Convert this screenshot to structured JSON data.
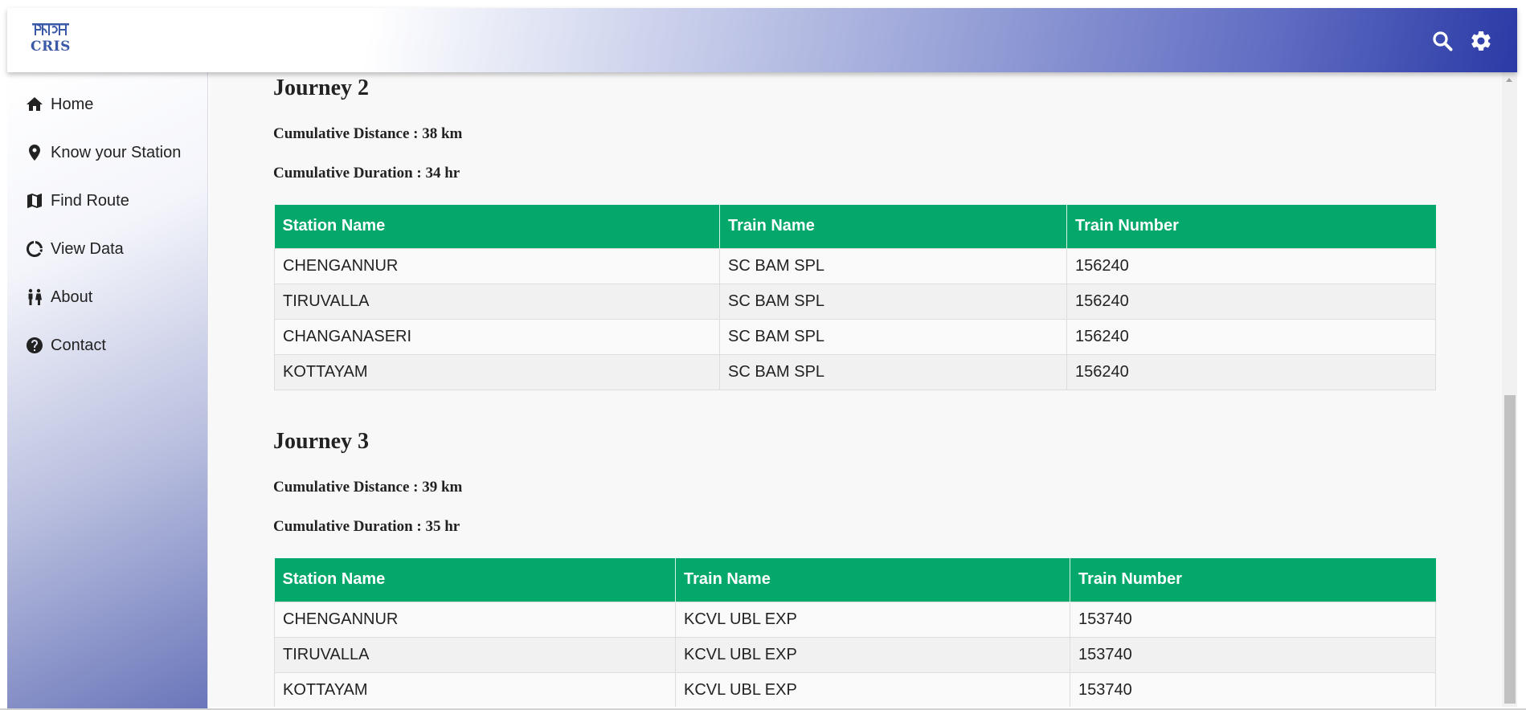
{
  "header": {
    "logo_text": "CRIS",
    "logo_hindi": "क्रिस",
    "search_icon": "search-icon",
    "settings_icon": "gear-icon",
    "accent": "#2b3aa6"
  },
  "sidebar": {
    "items": [
      {
        "label": "Home",
        "icon": "home-icon"
      },
      {
        "label": "Know your Station",
        "icon": "location-pin-icon"
      },
      {
        "label": "Find Route",
        "icon": "map-icon"
      },
      {
        "label": "View Data",
        "icon": "ring-chart-icon"
      },
      {
        "label": "About",
        "icon": "people-icon"
      },
      {
        "label": "Contact",
        "icon": "help-circle-icon"
      }
    ]
  },
  "journeys": [
    {
      "title": "Journey 2",
      "distance": "Cumulative Distance : 38 km",
      "duration": "Cumulative Duration : 34 hr",
      "columns": [
        "Station Name",
        "Train Name",
        "Train Number"
      ],
      "rows": [
        [
          "CHENGANNUR",
          "SC BAM SPL",
          "156240"
        ],
        [
          "TIRUVALLA",
          "SC BAM SPL",
          "156240"
        ],
        [
          "CHANGANASERI",
          "SC BAM SPL",
          "156240"
        ],
        [
          "KOTTAYAM",
          "SC BAM SPL",
          "156240"
        ]
      ]
    },
    {
      "title": "Journey 3",
      "distance": "Cumulative Distance : 39 km",
      "duration": "Cumulative Duration : 35 hr",
      "columns": [
        "Station Name",
        "Train Name",
        "Train Number"
      ],
      "rows": [
        [
          "CHENGANNUR",
          "KCVL UBL EXP",
          "153740"
        ],
        [
          "TIRUVALLA",
          "KCVL UBL EXP",
          "153740"
        ],
        [
          "KOTTAYAM",
          "KCVL UBL EXP",
          "153740"
        ]
      ]
    }
  ],
  "colors": {
    "table_header": "#04a86b"
  }
}
